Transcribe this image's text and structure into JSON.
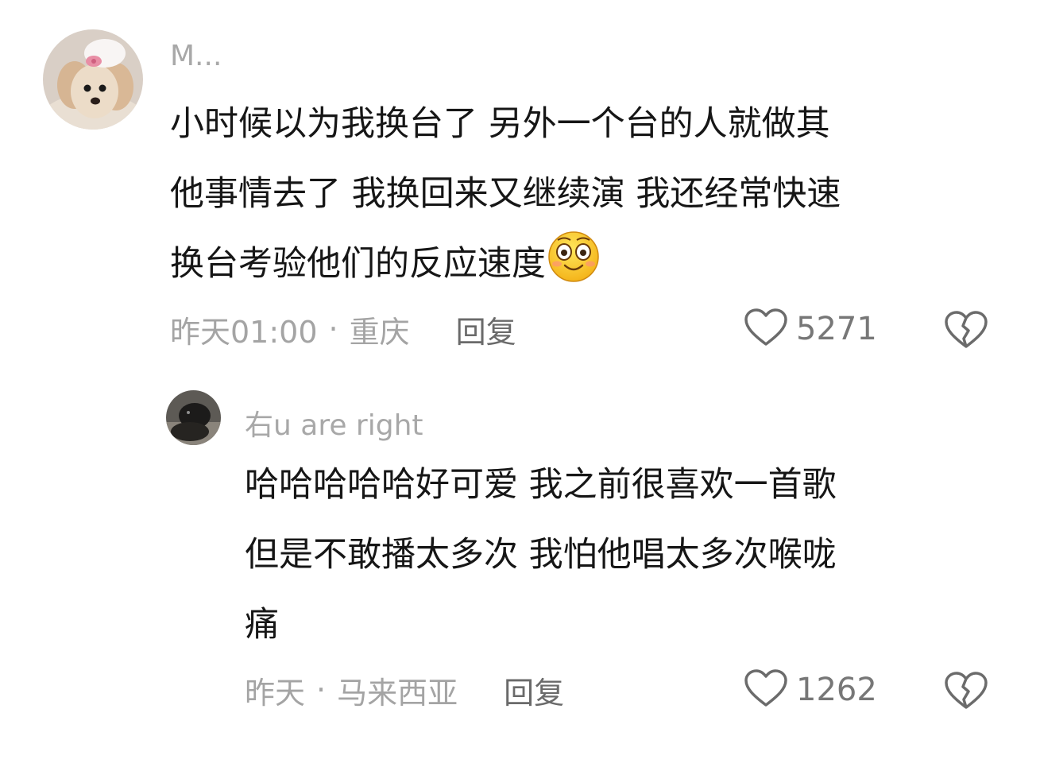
{
  "comments": [
    {
      "username": "M...",
      "avatar_icon": "poodle-avatar",
      "text_lines": [
        "小时候以为我换台了 另外一个台的人就做其",
        "他事情去了 我换回来又继续演 我还经常快速",
        "换台考验他们的反应速度"
      ],
      "emoji_icon": "smiling-emoji-icon",
      "time": "昨天01:00",
      "separator": "·",
      "location": "重庆",
      "reply_label": "回复",
      "like_count": "5271"
    },
    {
      "username": "右u are right",
      "avatar_icon": "dark-photo-avatar",
      "text_lines": [
        "哈哈哈哈哈好可爱 我之前很喜欢一首歌",
        "但是不敢播太多次 我怕他唱太多次喉咙",
        "痛"
      ],
      "time": "昨天",
      "separator": "·",
      "location": "马来西亚",
      "reply_label": "回复",
      "like_count": "1262"
    }
  ],
  "colors": {
    "text": "#161616",
    "muted": "#a4a4a4",
    "reply": "#6a6a6a"
  }
}
